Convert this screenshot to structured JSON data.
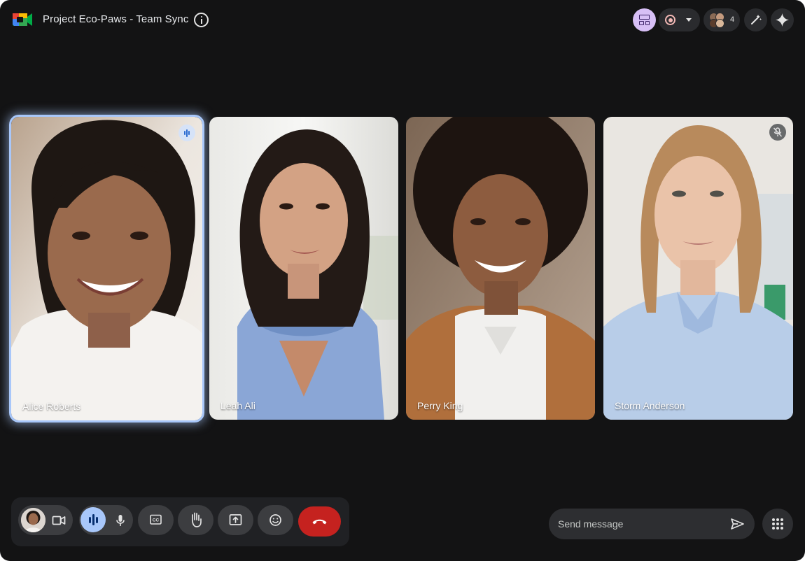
{
  "meeting": {
    "title": "Project Eco-Paws - Team Sync",
    "participant_count": "4"
  },
  "colors": {
    "accent_speaking": "#a8c7fa",
    "layout_button": "#d7bff6",
    "end_call": "#c5221f",
    "background": "#131314"
  },
  "toolbar_top": {
    "icons": [
      "meet-logo-icon",
      "info-icon",
      "layout-icon",
      "record-icon",
      "people-icon",
      "effects-wand-icon",
      "gemini-sparkle-icon"
    ]
  },
  "participants": [
    {
      "name": "Alice Roberts",
      "state": "speaking"
    },
    {
      "name": "Leah Ali",
      "state": "normal"
    },
    {
      "name": "Perry King",
      "state": "normal"
    },
    {
      "name": "Storm Anderson",
      "state": "muted"
    }
  ],
  "controls": {
    "icons": [
      "camera-icon",
      "microphone-icon",
      "captions-icon",
      "raise-hand-icon",
      "present-screen-icon",
      "emoji-icon",
      "end-call-icon"
    ]
  },
  "chat": {
    "placeholder": "Send message"
  }
}
